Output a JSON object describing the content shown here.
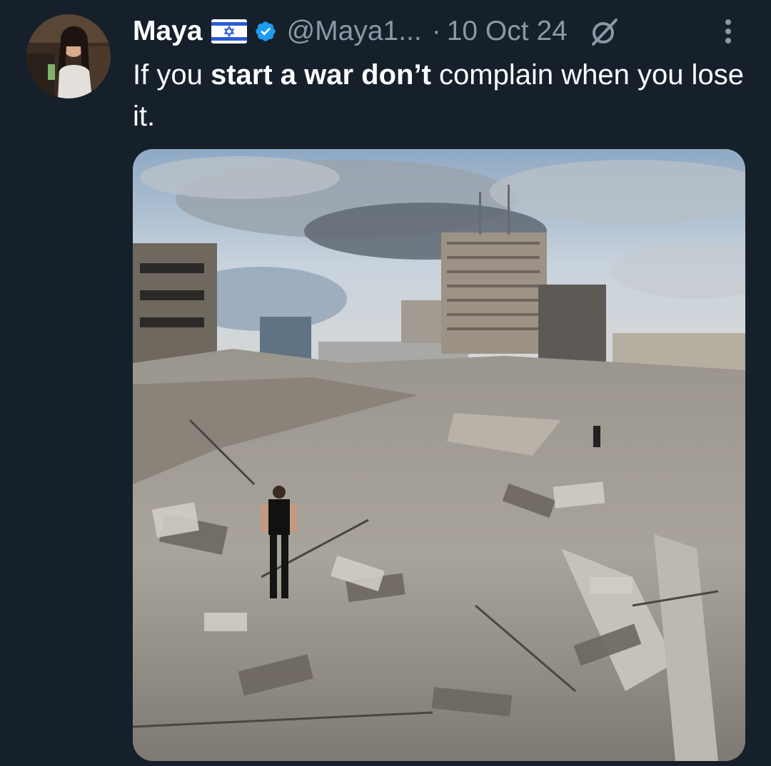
{
  "tweet": {
    "author": {
      "display_name": "Maya",
      "flag": "🇮🇱",
      "verified_icon": "verified-badge-icon",
      "handle": "@Maya1...",
      "separator": "·",
      "timestamp": "10 Oct 24"
    },
    "text": {
      "part1": "If you ",
      "part2_bold": "start a war don’t",
      "part3": " complain when you lose it."
    },
    "icons": {
      "grok": "grok-slash-icon",
      "more": "more-vertical-icon"
    },
    "colors": {
      "background": "#15202b",
      "secondary_text": "#8b98a5",
      "verified": "#1d9bf0"
    }
  }
}
